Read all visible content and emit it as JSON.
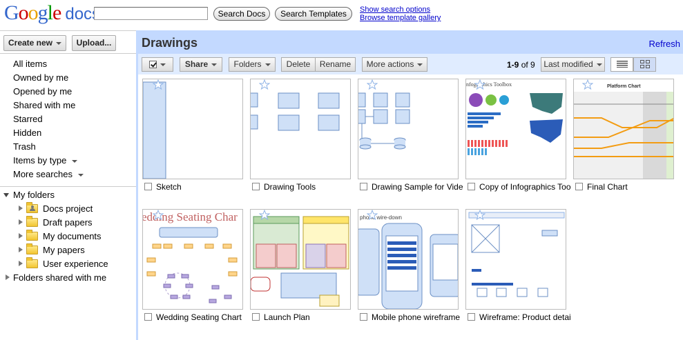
{
  "header": {
    "logo_google": [
      "G",
      "o",
      "o",
      "g",
      "l",
      "e"
    ],
    "logo_docs": "docs",
    "search_placeholder": "",
    "search_docs_label": "Search Docs",
    "search_templates_label": "Search Templates",
    "show_search_options": "Show search options",
    "browse_template_gallery": "Browse template gallery"
  },
  "sidebar": {
    "create_new_label": "Create new",
    "upload_label": "Upload...",
    "nav": [
      "All items",
      "Owned by me",
      "Opened by me",
      "Shared with me",
      "Starred",
      "Hidden",
      "Trash",
      "Items by type",
      "More searches"
    ],
    "my_folders_label": "My folders",
    "folders": [
      "Docs project",
      "Draft papers",
      "My documents",
      "My papers",
      "User experience"
    ],
    "shared_folders_label": "Folders shared with me"
  },
  "main": {
    "title": "Drawings",
    "refresh_label": "Refresh",
    "toolbar": {
      "share": "Share",
      "folders": "Folders",
      "delete": "Delete",
      "rename": "Rename",
      "more_actions": "More actions",
      "count_range": "1-9",
      "count_of": "of 9",
      "sort": "Last modified"
    },
    "items": [
      {
        "title": "Sketch"
      },
      {
        "title": "Drawing Tools"
      },
      {
        "title": "Drawing Sample for Video"
      },
      {
        "title": "Copy of Infographics Tool"
      },
      {
        "title": "Final Chart"
      },
      {
        "title": "Wedding Seating Chart"
      },
      {
        "title": "Launch Plan"
      },
      {
        "title": "Mobile phone wireframe"
      },
      {
        "title": "Wireframe: Product details"
      }
    ],
    "thumb_text": {
      "infographics": "nfographics Toolbox",
      "platform": "Platform Chart",
      "wedding": "edding Seating Char",
      "mobile": "phone wire-down"
    }
  },
  "colors": {
    "title_bar": "#c3d9ff",
    "toolbar": "#e0ecff",
    "link": "#0000cc",
    "shape_fill": "#cfe0f7",
    "shape_stroke": "#6b8fc4"
  }
}
